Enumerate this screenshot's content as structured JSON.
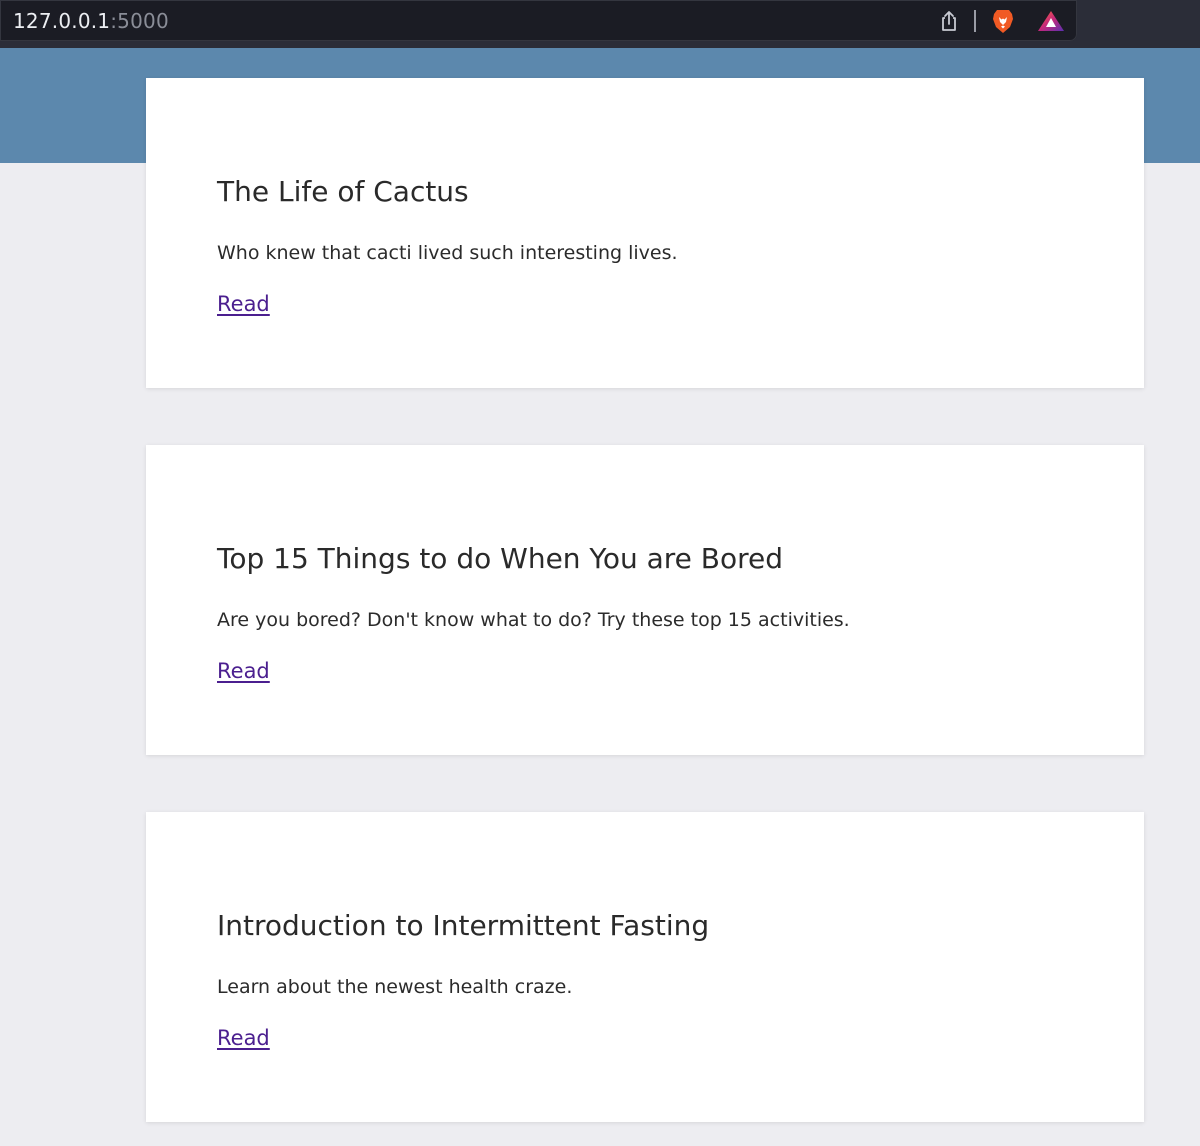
{
  "browser": {
    "url_host": "127.0.0.1",
    "url_port": ":5000",
    "icons": [
      "share-icon",
      "brave-shields-icon",
      "brave-rewards-icon"
    ]
  },
  "colors": {
    "hero_band": "#5c88ad",
    "page_background": "#ededf1",
    "card_background": "#ffffff",
    "link": "#4b1f8f"
  },
  "posts": [
    {
      "title": "The Life of Cactus",
      "description": "Who knew that cacti lived such interesting lives.",
      "link_label": "Read"
    },
    {
      "title": "Top 15 Things to do When You are Bored",
      "description": "Are you bored? Don't know what to do? Try these top 15 activities.",
      "link_label": "Read"
    },
    {
      "title": "Introduction to Intermittent Fasting",
      "description": "Learn about the newest health craze.",
      "link_label": "Read"
    }
  ]
}
